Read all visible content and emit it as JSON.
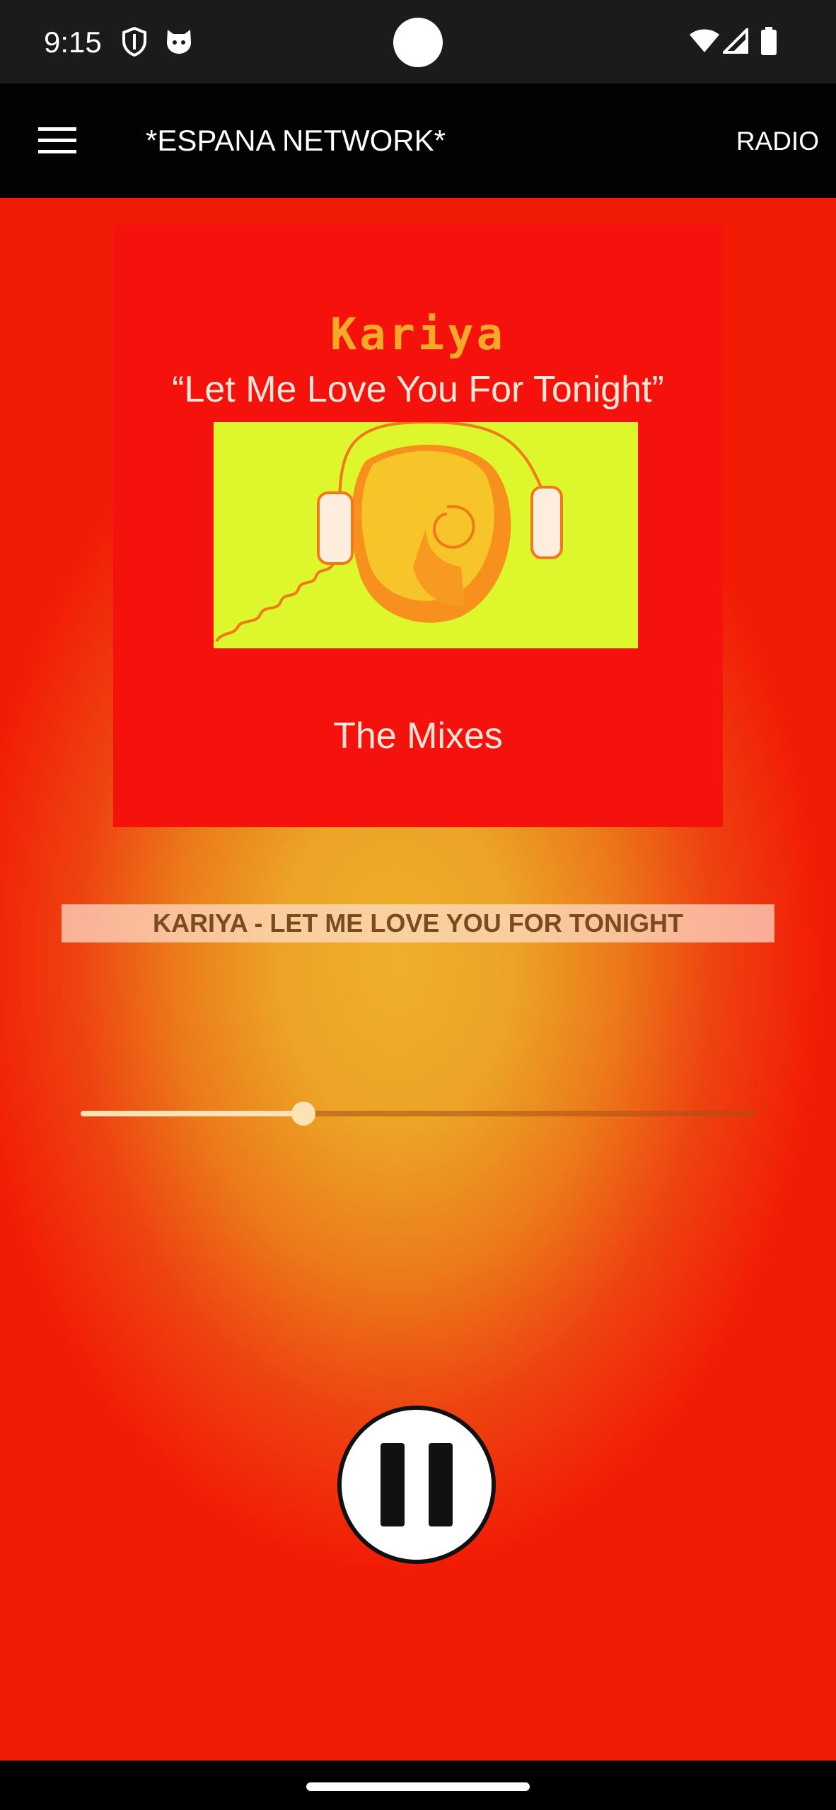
{
  "status_bar": {
    "time": "9:15",
    "left_icons": [
      "shield-icon",
      "cat-notification-icon"
    ],
    "right_icons": [
      "wifi-icon",
      "cell-signal-icon",
      "battery-icon"
    ]
  },
  "app_bar": {
    "title": "*ESPANA NETWORK*",
    "action_label": "RADIO",
    "menu_icon": "hamburger-menu-icon"
  },
  "album_art": {
    "artist": "Kariya",
    "song": "“Let Me Love You For Tonight”",
    "subtitle": "The Mixes",
    "image_icon": "headphones-face-illustration"
  },
  "now_playing": {
    "text": "KARIYA - LET ME LOVE YOU FOR TONIGHT"
  },
  "seek_bar": {
    "progress_fraction": 0.33
  },
  "controls": {
    "play_pause_icon": "pause-icon"
  },
  "colors": {
    "app_bar_bg": "#020202",
    "album_bg": "#f5120c",
    "album_image_bg": "#ddf72c",
    "artist_text": "#f6a828",
    "now_playing_text": "#7a4a21",
    "seek_color": "#fde3b4"
  }
}
